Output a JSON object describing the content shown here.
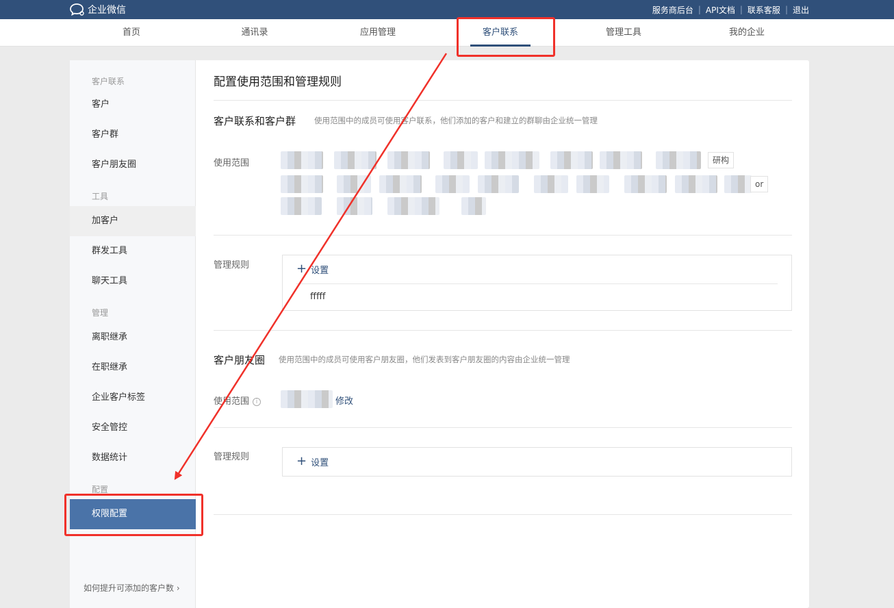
{
  "topbar": {
    "logo_text": "企业微信",
    "links": [
      "服务商后台",
      "API文档",
      "联系客服",
      "退出"
    ]
  },
  "nav": {
    "tabs": [
      "首页",
      "通讯录",
      "应用管理",
      "客户联系",
      "管理工具",
      "我的企业"
    ],
    "active": "客户联系"
  },
  "sidebar": {
    "groups": {
      "g1": "客户联系",
      "g2": "工具",
      "g3": "管理",
      "g4": "配置"
    },
    "items": {
      "customer": "客户",
      "customer_group": "客户群",
      "moments": "客户朋友圈",
      "add_customer": "加客户",
      "mass_send": "群发工具",
      "chat_tools": "聊天工具",
      "resign_inherit": "离职继承",
      "onjob_inherit": "在职继承",
      "customer_tags": "企业客户标签",
      "security": "安全管控",
      "data_stats": "数据统计",
      "permission": "权限配置"
    },
    "footer": "如何提升可添加的客户数"
  },
  "content": {
    "page_title": "配置使用范围和管理规则",
    "section1": {
      "title": "客户联系和客户群",
      "desc": "使用范围中的成员可使用客户联系，他们添加的客户和建立的群聊由企业统一管理",
      "scope_label": "使用范围",
      "chip_fragment_1": "研构",
      "chip_fragment_2": "or",
      "rules_label": "管理规则",
      "add_label": "设置",
      "rule_item": "fffff"
    },
    "section2": {
      "title": "客户朋友圈",
      "desc": "使用范围中的成员可使用客户朋友圈，他们发表到客户朋友圈的内容由企业统一管理",
      "scope_label": "使用范围",
      "info_icon": "i",
      "modify": "修改",
      "rules_label": "管理规则",
      "add_label": "设置"
    }
  },
  "colors": {
    "topbar": "#30507a",
    "selected": "#4a73a8",
    "annotation": "#f0312a"
  }
}
